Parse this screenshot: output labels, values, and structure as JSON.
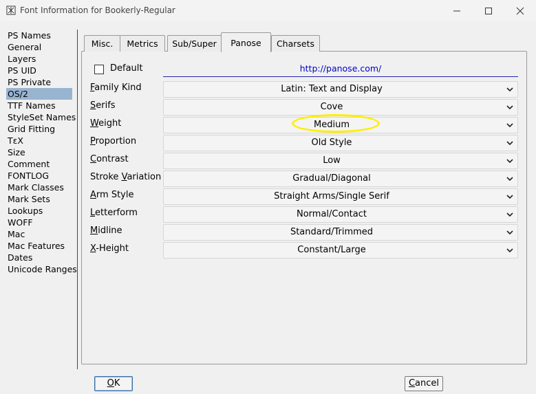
{
  "window": {
    "title": "Font Information for Bookerly-Regular"
  },
  "sidebar": {
    "items": [
      {
        "label": "PS Names"
      },
      {
        "label": "General"
      },
      {
        "label": "Layers"
      },
      {
        "label": "PS UID"
      },
      {
        "label": "PS Private"
      },
      {
        "label": "OS/2"
      },
      {
        "label": "TTF Names"
      },
      {
        "label": "StyleSet Names"
      },
      {
        "label": "Grid Fitting"
      },
      {
        "label": "TεX"
      },
      {
        "label": "Size"
      },
      {
        "label": "Comment"
      },
      {
        "label": "FONTLOG"
      },
      {
        "label": "Mark Classes"
      },
      {
        "label": "Mark Sets"
      },
      {
        "label": "Lookups"
      },
      {
        "label": "WOFF"
      },
      {
        "label": "Mac"
      },
      {
        "label": "Mac Features"
      },
      {
        "label": "Dates"
      },
      {
        "label": "Unicode Ranges"
      }
    ],
    "selected": "OS/2"
  },
  "tabs": [
    {
      "label": "Misc."
    },
    {
      "label": "Metrics"
    },
    {
      "label": "Sub/Super"
    },
    {
      "label": "Panose"
    },
    {
      "label": "Charsets"
    }
  ],
  "active_tab": "Panose",
  "panose": {
    "default_label": "Default",
    "default_checked": false,
    "link": "http://panose.com/",
    "rows": [
      {
        "label_first": "F",
        "label_rest": "amily Kind",
        "value": "Latin: Text and Display"
      },
      {
        "label_first": "S",
        "label_rest": "erifs",
        "value": "Cove"
      },
      {
        "label_first": "W",
        "label_rest": "eight",
        "value": "Medium"
      },
      {
        "label_first": "P",
        "label_rest": "roportion",
        "value": "Old Style"
      },
      {
        "label_first": "C",
        "label_rest": "ontrast",
        "value": "Low"
      },
      {
        "label_pre": "Stroke ",
        "label_first": "V",
        "label_rest": "ariation",
        "value": "Gradual/Diagonal"
      },
      {
        "label_first": "A",
        "label_rest": "rm Style",
        "value": "Straight Arms/Single Serif"
      },
      {
        "label_first": "L",
        "label_rest": "etterform",
        "value": "Normal/Contact"
      },
      {
        "label_first": "M",
        "label_rest": "idline",
        "value": "Standard/Trimmed"
      },
      {
        "label_first": "X",
        "label_rest": "-Height",
        "value": "Constant/Large"
      }
    ]
  },
  "buttons": {
    "ok_first": "O",
    "ok_rest": "K",
    "cancel_first": "C",
    "cancel_rest": "ancel"
  },
  "colors": {
    "selection": "#99b4d1",
    "link": "#0000cc",
    "highlight": "#ffee00"
  }
}
